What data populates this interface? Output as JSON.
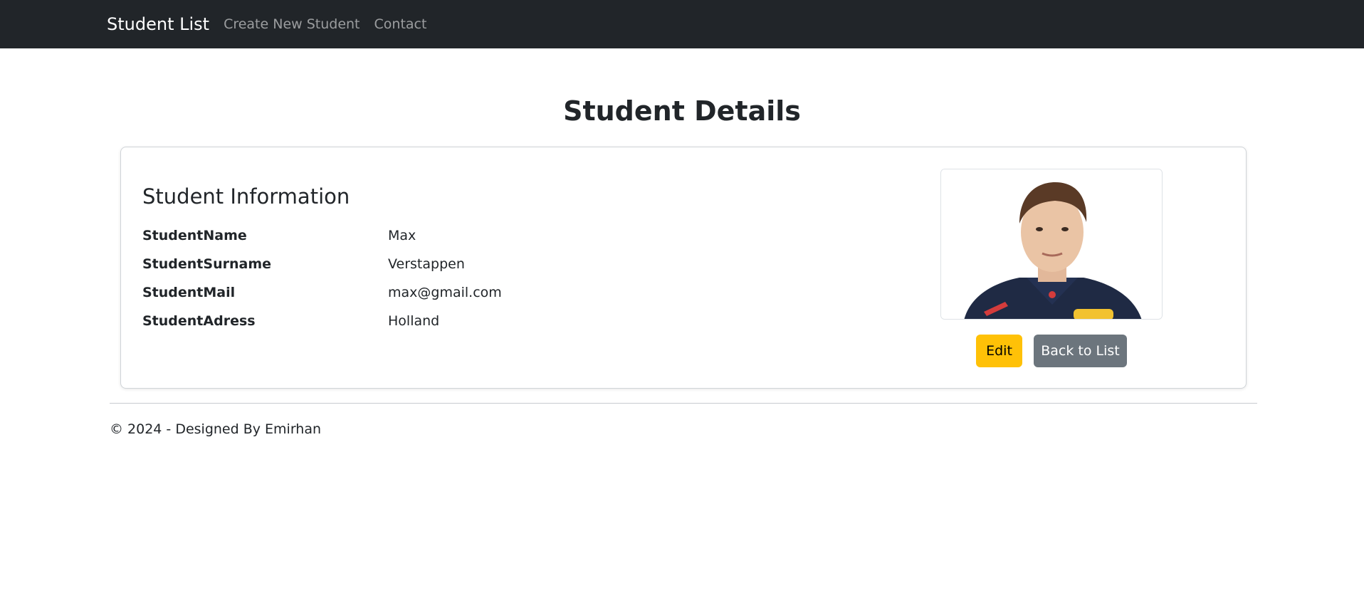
{
  "navbar": {
    "brand": "Student List",
    "links": [
      "Create New Student",
      "Contact"
    ]
  },
  "page": {
    "title": "Student Details"
  },
  "card": {
    "title": "Student Information",
    "fields": [
      {
        "label": "StudentName",
        "value": "Max"
      },
      {
        "label": "StudentSurname",
        "value": "Verstappen"
      },
      {
        "label": "StudentMail",
        "value": "max@gmail.com"
      },
      {
        "label": "StudentAdress",
        "value": "Holland"
      }
    ],
    "photo_alt": "student-photo",
    "edit_label": "Edit",
    "back_label": "Back to List"
  },
  "footer": {
    "text": "© 2024 - Designed By Emirhan"
  },
  "colors": {
    "navbar_bg": "#212529",
    "edit_button": "#ffc107",
    "back_button": "#6c757d"
  }
}
